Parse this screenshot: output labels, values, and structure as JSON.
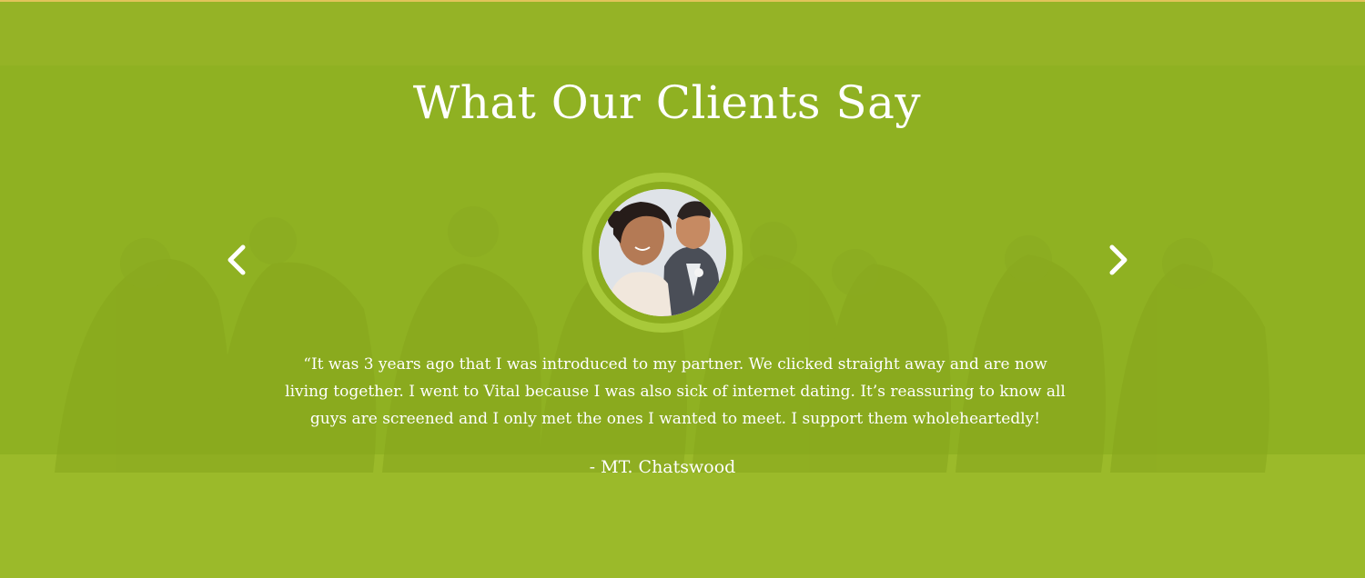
{
  "section": {
    "title": "What Our Clients Say",
    "background_color": "#93b324",
    "accent_ring_color": "#a8c93a"
  },
  "carousel": {
    "prev_icon": "chevron-left-icon",
    "next_icon": "chevron-right-icon"
  },
  "testimonial": {
    "avatar_alt": "client-couple-photo",
    "quote": "“It was 3 years ago that I was introduced to my partner. We clicked straight away and are now living together. I went to Vital because I was also sick of internet dating. It’s reassuring to know all guys are screened and I only met the ones I wanted to meet.  I support them wholeheartedly!",
    "author": "- MT. Chatswood"
  }
}
